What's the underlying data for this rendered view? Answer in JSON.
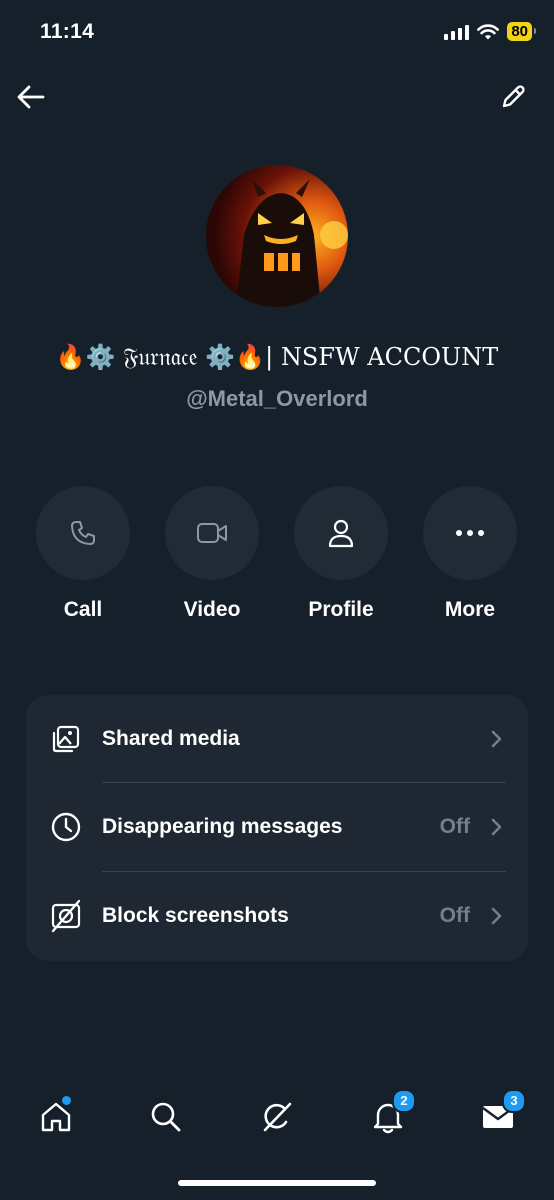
{
  "status_bar": {
    "time": "11:14",
    "battery": "80",
    "battery_color": "#f2d31b"
  },
  "nav": {
    "back_icon": "arrow-left-icon",
    "edit_icon": "pencil-icon"
  },
  "profile": {
    "display_name": "🔥⚙️ 𝔉𝔲𝔯𝔫𝔞𝔠𝔢 ⚙️🔥| NSFW ACCOUNT",
    "handle": "@Metal_Overlord",
    "avatar_icon": "avatar-image"
  },
  "actions": [
    {
      "label": "Call",
      "icon": "phone-icon"
    },
    {
      "label": "Video",
      "icon": "video-camera-icon"
    },
    {
      "label": "Profile",
      "icon": "person-icon"
    },
    {
      "label": "More",
      "icon": "more-dots-icon"
    }
  ],
  "settings": [
    {
      "label": "Shared media",
      "value": "",
      "icon": "gallery-icon"
    },
    {
      "label": "Disappearing messages",
      "value": "Off",
      "icon": "clock-icon"
    },
    {
      "label": "Block screenshots",
      "value": "Off",
      "icon": "no-screenshot-icon"
    }
  ],
  "tabbar": {
    "home_icon": "home-icon",
    "search_icon": "search-icon",
    "grok_icon": "grok-icon",
    "notifications_badge": "2",
    "messages_badge": "3"
  },
  "colors": {
    "background": "#15202b",
    "card": "#1e2732",
    "accent": "#1d9bf0",
    "muted": "#8b98a5"
  }
}
